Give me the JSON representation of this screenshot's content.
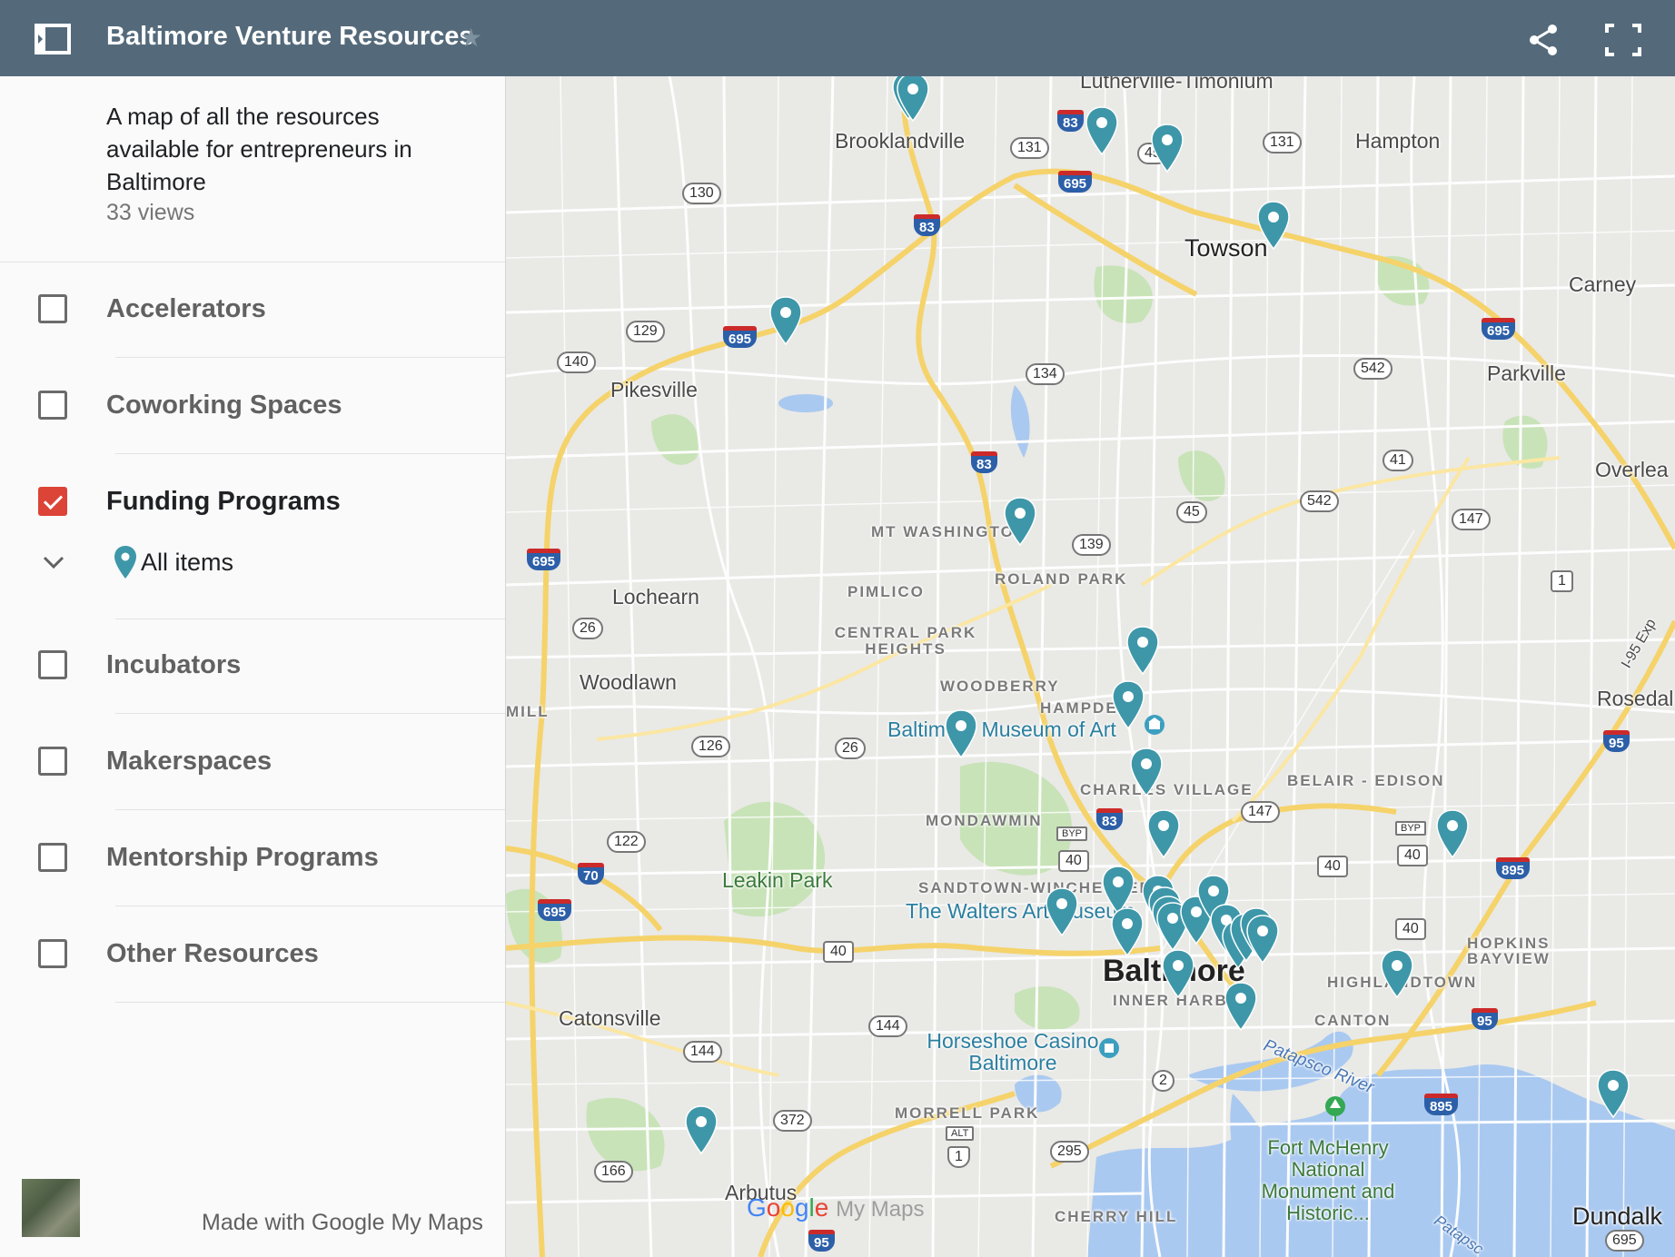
{
  "header": {
    "title": "Baltimore Venture Resources",
    "bg_color": "#546a7b"
  },
  "sidebar": {
    "description": "A map of all the resources available for entrepreneurs in Baltimore",
    "views": "33 views",
    "layers": [
      {
        "label": "Accelerators",
        "checked": false
      },
      {
        "label": "Coworking Spaces",
        "checked": false
      },
      {
        "label": "Funding Programs",
        "checked": true
      },
      {
        "label": "Incubators",
        "checked": false
      },
      {
        "label": "Makerspaces",
        "checked": false
      },
      {
        "label": "Mentorship Programs",
        "checked": false
      },
      {
        "label": "Other Resources",
        "checked": false
      }
    ],
    "sublayer": {
      "label": "All items"
    },
    "footer": "Made with Google My Maps"
  },
  "map": {
    "pin_color": "#3e97a9",
    "places": {
      "lutherville": "Lutherville-Timonium",
      "brooklandville": "Brooklandville",
      "hampton": "Hampton",
      "towson": "Towson",
      "carney": "Carney",
      "pikesville": "Pikesville",
      "parkville": "Parkville",
      "overlea": "Overlea",
      "lochearn": "Lochearn",
      "woodlawn": "Woodlawn",
      "rosedale": "Rosedal",
      "catonsville": "Catonsville",
      "arbutus": "Arbutus",
      "dundalk": "Dundalk",
      "baltimore": "Baltimore",
      "mt_washington": "MT WASHINGTON",
      "pimlico": "PIMLICO",
      "roland_park": "ROLAND PARK",
      "central_park_heights": "CENTRAL PARK HEIGHTS",
      "woodberry": "WOODBERRY",
      "hampden": "HAMPDEN",
      "charles_village": "CHARLES VILLAGE",
      "belair_edison": "BELAIR - EDISON",
      "mondawmin": "MONDAWMIN",
      "sandtown": "SANDTOWN-WINCHESTER",
      "hopkins_bayview": "HOPKINS BAYVIEW",
      "highlandtown": "HIGHLANDTOWN",
      "inner_harbor": "INNER HARBOR",
      "canton": "CANTON",
      "morrell_park": "MORRELL PARK",
      "cherry_hill": "CHERRY HILL",
      "mill": "MILL",
      "museum_art": "Baltimore Museum of Art",
      "walters": "The Walters Art Museum",
      "horseshoe": "Horseshoe Casino Baltimore",
      "leakin_park": "Leakin Park",
      "fort_mchenry": "Fort McHenry National Monument and Historic...",
      "patapsco": "Patapsco River",
      "patapsco2": "Patapsc",
      "i95exp": "I-95 Exp",
      "google": "Google My Maps"
    },
    "route_shields": [
      "130",
      "131",
      "45",
      "131",
      "83",
      "695",
      "83",
      "129",
      "695",
      "140",
      "134",
      "542",
      "695",
      "83",
      "41",
      "542",
      "147",
      "45",
      "139",
      "1",
      "695",
      "26",
      "126",
      "26",
      "122",
      "70",
      "695",
      "40",
      "40",
      "BYP",
      "83",
      "147",
      "BYP",
      "40",
      "95",
      "895",
      "40",
      "40",
      "144",
      "144",
      "2",
      "372",
      "ALT",
      "1",
      "295",
      "166",
      "95",
      "895",
      "95",
      "695"
    ]
  }
}
